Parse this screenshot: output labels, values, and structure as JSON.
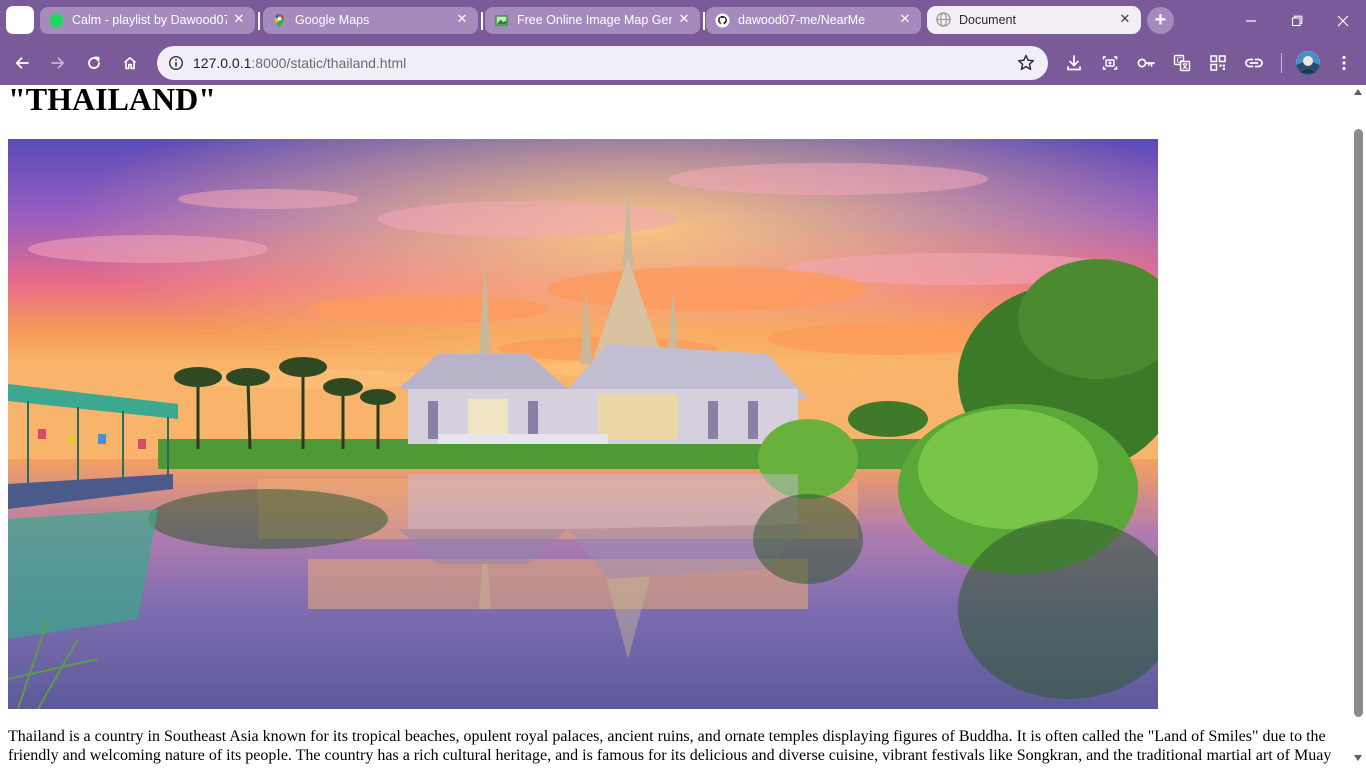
{
  "browser": {
    "tabs": [
      {
        "title": "Calm - playlist by Dawood07",
        "favicon": "spotify-icon",
        "active": false
      },
      {
        "title": "Google Maps",
        "favicon": "google-maps-icon",
        "active": false
      },
      {
        "title": "Free Online Image Map Generator",
        "favicon": "image-map-icon",
        "active": false
      },
      {
        "title": "dawood07-me/NearMe",
        "favicon": "github-icon",
        "active": false
      },
      {
        "title": "Document",
        "favicon": "globe-icon",
        "active": true
      }
    ],
    "address_bar": {
      "host": "127.0.0.1",
      "path": ":8000/static/thailand.html"
    },
    "theme_color": "#7a5a99"
  },
  "page": {
    "heading": "\"THAILAND\"",
    "image_alt": "Thai temple at sunset reflected in a pond",
    "paragraph": "Thailand is a country in Southeast Asia known for its tropical beaches, opulent royal palaces, ancient ruins, and ornate temples displaying figures of Buddha. It is often called the \"Land of Smiles\" due to the friendly and welcoming nature of its people. The country has a rich cultural heritage, and is famous for its delicious and diverse cuisine, vibrant festivals like Songkran, and the traditional martial art of Muay"
  }
}
